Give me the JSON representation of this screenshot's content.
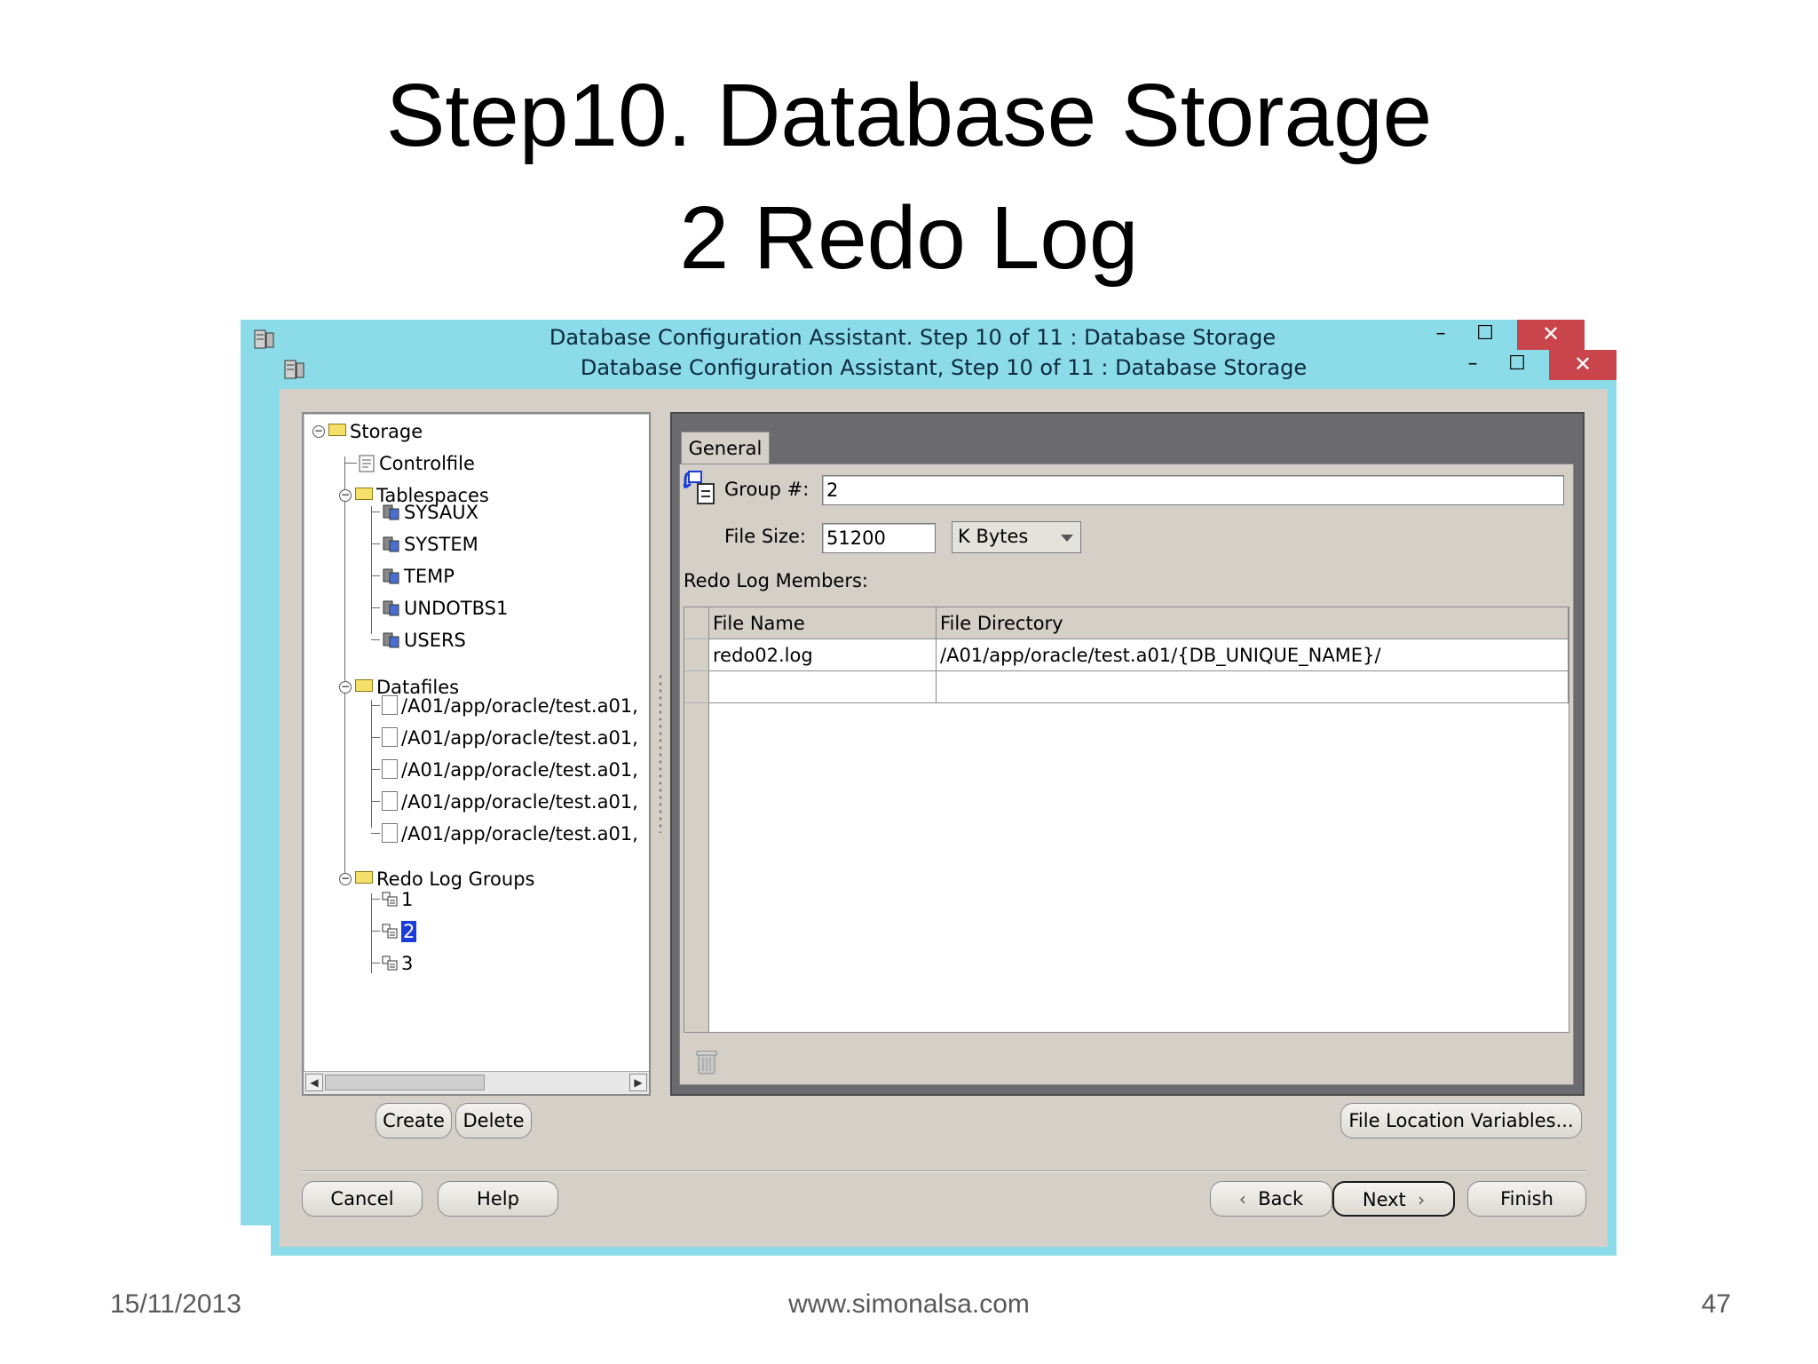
{
  "slide": {
    "title_line1": "Step10. Database Storage",
    "title_line2": "2 Redo Log",
    "footer_date": "15/11/2013",
    "footer_site": "www.simonalsa.com",
    "footer_page": "47"
  },
  "window": {
    "title": "Database Configuration Assistant, Step 10 of 11 : Database Storage",
    "title_back": "Database Configuration Assistant. Step 10 of 11 : Database Storage",
    "minimize_glyph": "–",
    "maximize_glyph": "☐",
    "close_glyph": "✕"
  },
  "tree": {
    "root": "Storage",
    "controlfile": "Controlfile",
    "tablespaces": "Tablespaces",
    "tablespace_items": [
      "SYSAUX",
      "SYSTEM",
      "TEMP",
      "UNDOTBS1",
      "USERS"
    ],
    "datafiles": "Datafiles",
    "datafile_items": [
      "/A01/app/oracle/test.a01,",
      "/A01/app/oracle/test.a01,",
      "/A01/app/oracle/test.a01,",
      "/A01/app/oracle/test.a01,",
      "/A01/app/oracle/test.a01,"
    ],
    "redo_groups": "Redo Log Groups",
    "redo_items": [
      "1",
      "2",
      "3"
    ],
    "selected_redo": "2"
  },
  "general": {
    "tab_label": "General",
    "group_label": "Group #:",
    "group_value": "2",
    "file_size_label": "File Size:",
    "file_size_value": "51200",
    "unit_value": "K Bytes",
    "members_label": "Redo Log Members:",
    "columns": [
      "File Name",
      "File Directory"
    ],
    "rows": [
      [
        "redo02.log",
        "/A01/app/oracle/test.a01/{DB_UNIQUE_NAME}/"
      ],
      [
        "",
        ""
      ]
    ]
  },
  "buttons": {
    "create": "Create",
    "delete": "Delete",
    "file_location_variables": "File Location Variables...",
    "cancel": "Cancel",
    "help": "Help",
    "back": "Back",
    "next": "Next",
    "finish": "Finish"
  },
  "colors": {
    "titlebar": "#8bdbe8",
    "close_button": "#c9444b",
    "dialog_bg": "#d4d0c8",
    "selection": "#1a3cd8"
  }
}
